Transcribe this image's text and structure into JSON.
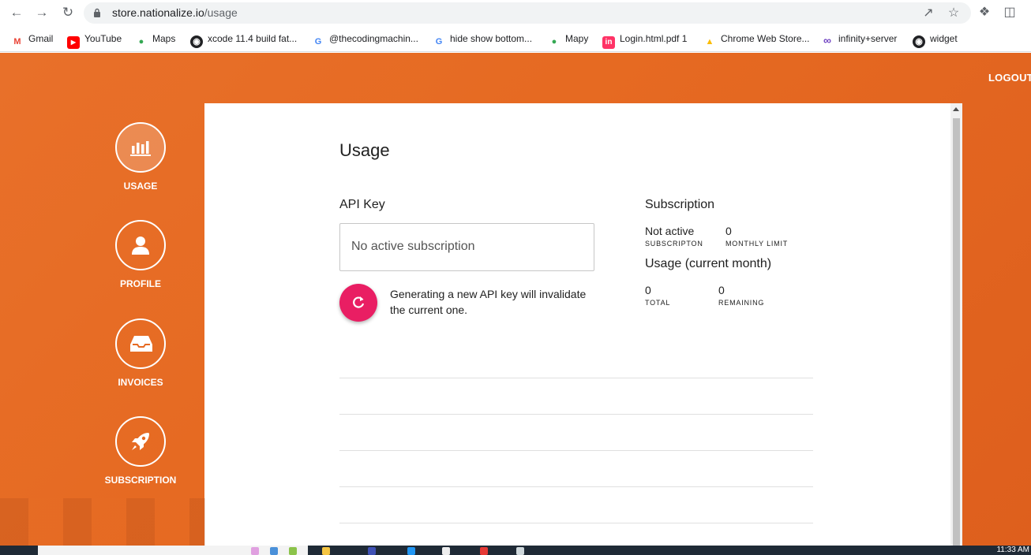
{
  "browser": {
    "url_domain": "store.nationalize.io",
    "url_path": "/usage",
    "bookmarks": [
      {
        "label": "Gmail",
        "icon": "gmail-icon",
        "color": "#ea4335"
      },
      {
        "label": "YouTube",
        "icon": "youtube-icon",
        "color": "#ff0000"
      },
      {
        "label": "Maps",
        "icon": "maps-pin-icon",
        "color": "#34a853"
      },
      {
        "label": "xcode 11.4 build fat...",
        "icon": "github-icon",
        "color": "#202124"
      },
      {
        "label": "@thecodingmachin...",
        "icon": "google-icon",
        "color": "#4285f4"
      },
      {
        "label": "hide show bottom...",
        "icon": "google-icon",
        "color": "#4285f4"
      },
      {
        "label": "Mapy",
        "icon": "maps-pin-icon",
        "color": "#34a853"
      },
      {
        "label": "Login.html.pdf 1",
        "icon": "invision-icon",
        "color": "#ff3366"
      },
      {
        "label": "Chrome Web Store...",
        "icon": "chrome-store-icon",
        "color": "#fbbc05"
      },
      {
        "label": "infinity+server",
        "icon": "infinity-icon",
        "color": "#6f42c1"
      },
      {
        "label": "widget",
        "icon": "github-icon",
        "color": "#202124"
      }
    ]
  },
  "header": {
    "logout_label": "LOGOUT"
  },
  "sidebar": {
    "items": [
      {
        "label": "USAGE",
        "icon": "bar-chart-icon",
        "active": true
      },
      {
        "label": "PROFILE",
        "icon": "user-icon",
        "active": false
      },
      {
        "label": "INVOICES",
        "icon": "inbox-tray-icon",
        "active": false
      },
      {
        "label": "SUBSCRIPTION",
        "icon": "rocket-icon",
        "active": false
      }
    ]
  },
  "main": {
    "title": "Usage",
    "api_key": {
      "label": "API Key",
      "value": "No active subscription",
      "regenerate_note": "Generating a new API key will invalidate the current one."
    },
    "subscription": {
      "label": "Subscription",
      "status_value": "Not active",
      "status_caption": "SUBSCRIPTON",
      "limit_value": "0",
      "limit_caption": "MONTHLY LIMIT"
    },
    "usage": {
      "label": "Usage (current month)",
      "total_value": "0",
      "total_caption": "TOTAL",
      "remaining_value": "0",
      "remaining_caption": "REMAINING"
    }
  },
  "taskbar": {
    "clock": "11:33 AM"
  },
  "colors": {
    "accent_orange": "#e66a22",
    "regen_button": "#e91e63"
  }
}
